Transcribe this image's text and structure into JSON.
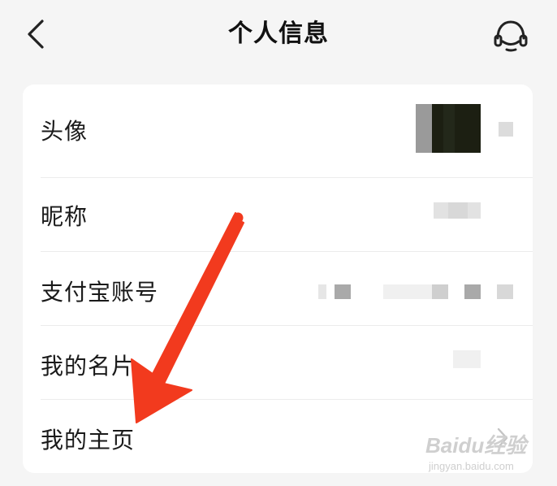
{
  "header": {
    "title": "个人信息"
  },
  "rows": [
    {
      "label": "头像"
    },
    {
      "label": "昵称"
    },
    {
      "label": "支付宝账号"
    },
    {
      "label": "我的名片"
    },
    {
      "label": "我的主页"
    }
  ],
  "watermark": {
    "logo": "Baidu经验",
    "sub": "jingyan.baidu.com"
  },
  "colors": {
    "annotation_arrow": "#f23a1e",
    "background": "#f5f5f5",
    "card": "#ffffff"
  },
  "icons": {
    "back": "back-icon",
    "support": "customer-service-icon",
    "chevron": "chevron-right-icon"
  }
}
